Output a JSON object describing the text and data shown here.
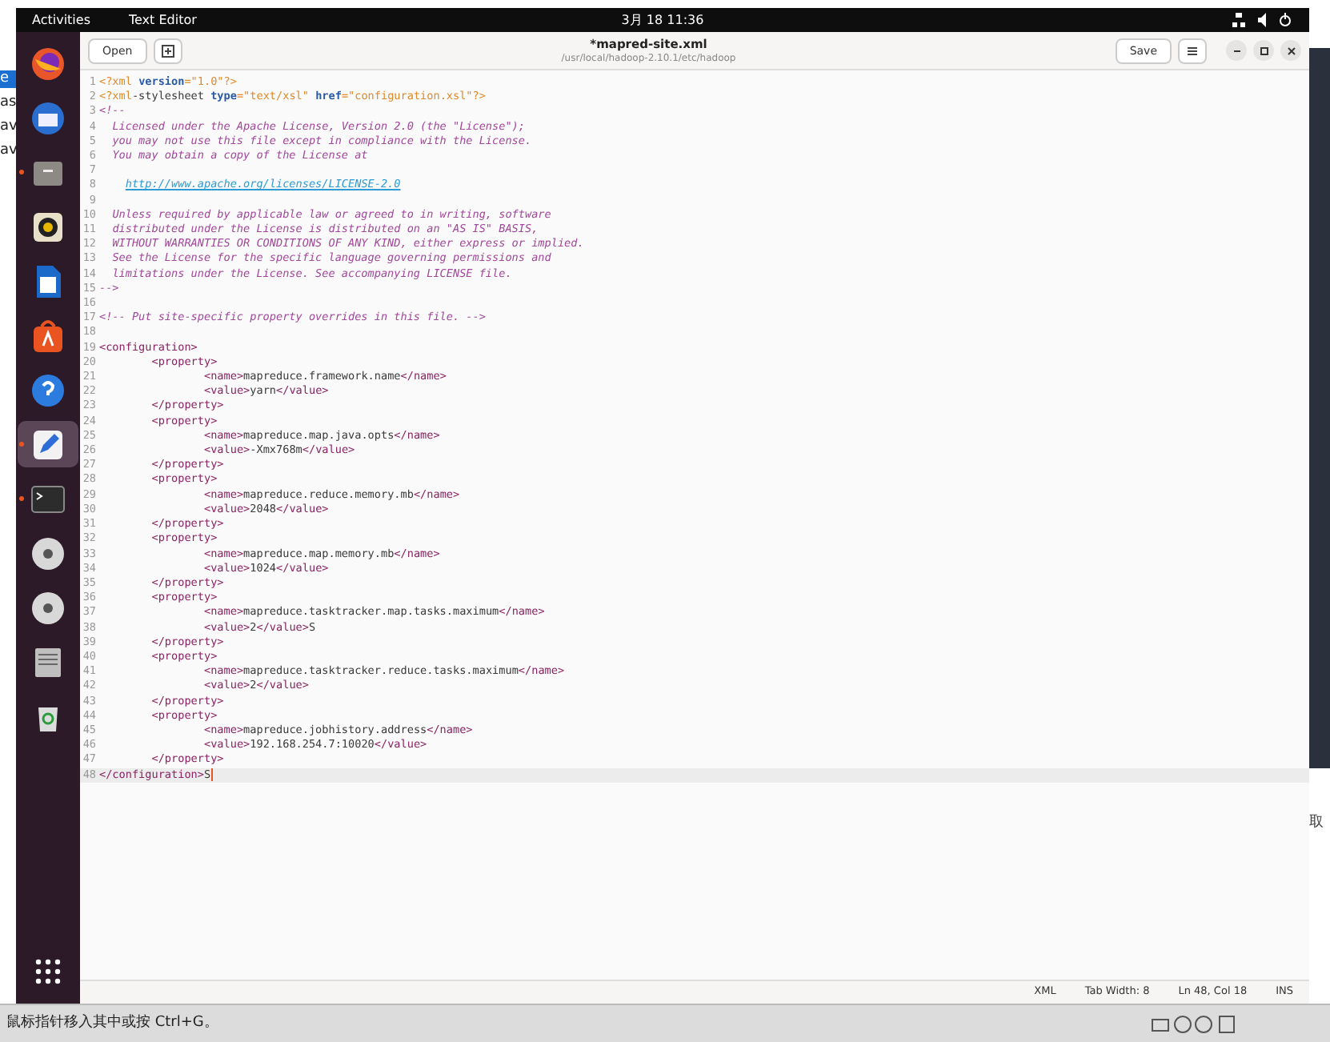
{
  "host_left": [
    {
      "text": "e",
      "selected": true
    },
    {
      "text": "as",
      "selected": false
    },
    {
      "text": "av",
      "selected": false
    },
    {
      "text": "av",
      "selected": false
    }
  ],
  "top_bar": {
    "activities": "Activities",
    "app": "Text Editor",
    "clock": "3月 18 11:36"
  },
  "dock": [
    {
      "kind": "firefox",
      "running": false,
      "selected": false
    },
    {
      "kind": "mail",
      "running": false,
      "selected": false
    },
    {
      "kind": "files",
      "running": true,
      "selected": false
    },
    {
      "kind": "speaker",
      "running": false,
      "selected": false
    },
    {
      "kind": "document",
      "running": false,
      "selected": false
    },
    {
      "kind": "store",
      "running": false,
      "selected": false
    },
    {
      "kind": "help",
      "running": false,
      "selected": false
    },
    {
      "kind": "editor",
      "running": true,
      "selected": true
    },
    {
      "kind": "terminal",
      "running": true,
      "selected": false
    },
    {
      "kind": "disc",
      "running": false,
      "selected": false
    },
    {
      "kind": "disc",
      "running": false,
      "selected": false
    },
    {
      "kind": "drive",
      "running": false,
      "selected": false
    },
    {
      "kind": "trash",
      "running": false,
      "selected": false
    },
    {
      "kind": "grid",
      "running": false,
      "selected": false
    }
  ],
  "header": {
    "open": "Open",
    "title": "*mapred-site.xml",
    "path": "/usr/local/hadoop-2.10.1/etc/hadoop",
    "save": "Save"
  },
  "lines": [
    {
      "number": "1",
      "segments": [
        {
          "kind": "decl",
          "text": "<?xml "
        },
        {
          "kind": "attr",
          "text": "version"
        },
        {
          "kind": "decl",
          "text": "=\"1.0\"?>"
        }
      ]
    },
    {
      "number": "2",
      "segments": [
        {
          "kind": "decl",
          "text": "<?xml"
        },
        {
          "kind": "plain",
          "text": "-stylesheet "
        },
        {
          "kind": "attr",
          "text": "type"
        },
        {
          "kind": "decl",
          "text": "=\"text/xsl\" "
        },
        {
          "kind": "attr",
          "text": "href"
        },
        {
          "kind": "decl",
          "text": "=\"configuration.xsl\"?>"
        }
      ]
    },
    {
      "number": "3",
      "segments": [
        {
          "kind": "comment",
          "text": "<!--"
        }
      ]
    },
    {
      "number": "4",
      "segments": [
        {
          "kind": "comment",
          "text": "  Licensed under the Apache License, Version 2.0 (the \"License\");"
        }
      ]
    },
    {
      "number": "5",
      "segments": [
        {
          "kind": "comment",
          "text": "  you may not use this file except in compliance with the License."
        }
      ]
    },
    {
      "number": "6",
      "segments": [
        {
          "kind": "comment",
          "text": "  You may obtain a copy of the License at"
        }
      ]
    },
    {
      "number": "7"
    },
    {
      "number": "8",
      "segments": [
        {
          "kind": "link",
          "text": "    http://www.apache.org/licenses/LICENSE-2.0"
        }
      ]
    },
    {
      "number": "9"
    },
    {
      "number": "10",
      "segments": [
        {
          "kind": "comment",
          "text": "  Unless required by applicable law or agreed to in writing, software"
        }
      ]
    },
    {
      "number": "11",
      "segments": [
        {
          "kind": "comment",
          "text": "  distributed under the License is distributed on an \"AS IS\" BASIS,"
        }
      ]
    },
    {
      "number": "12",
      "segments": [
        {
          "kind": "comment",
          "text": "  WITHOUT WARRANTIES OR CONDITIONS OF ANY KIND, either express or implied."
        }
      ]
    },
    {
      "number": "13",
      "segments": [
        {
          "kind": "comment",
          "text": "  See the License for the specific language governing permissions and"
        }
      ]
    },
    {
      "number": "14",
      "segments": [
        {
          "kind": "comment",
          "text": "  limitations under the License. See accompanying LICENSE file."
        }
      ]
    },
    {
      "number": "15",
      "segments": [
        {
          "kind": "comment",
          "text": "-->"
        }
      ]
    },
    {
      "number": "16"
    },
    {
      "number": "17",
      "segments": [
        {
          "kind": "comment",
          "text": "<!-- Put site-specific property overrides in this file. -->"
        }
      ]
    },
    {
      "number": "18"
    },
    {
      "number": "19",
      "segments": [
        {
          "kind": "tag",
          "text": "<configuration>"
        }
      ]
    },
    {
      "number": "20",
      "segments": [
        {
          "kind": "tag",
          "text": "\t<property>"
        }
      ]
    },
    {
      "number": "21",
      "segments": [
        {
          "kind": "tag",
          "text": "\t\t<name>"
        },
        {
          "kind": "plain",
          "text": "mapreduce.framework.name"
        },
        {
          "kind": "tag",
          "text": "</name>"
        }
      ]
    },
    {
      "number": "22",
      "segments": [
        {
          "kind": "tag",
          "text": "\t\t<value>"
        },
        {
          "kind": "plain",
          "text": "yarn"
        },
        {
          "kind": "tag",
          "text": "</value>"
        }
      ]
    },
    {
      "number": "23",
      "segments": [
        {
          "kind": "tag",
          "text": "\t</property>"
        }
      ]
    },
    {
      "number": "24",
      "segments": [
        {
          "kind": "tag",
          "text": "\t<property>"
        }
      ]
    },
    {
      "number": "25",
      "segments": [
        {
          "kind": "tag",
          "text": "\t\t<name>"
        },
        {
          "kind": "plain",
          "text": "mapreduce.map.java.opts"
        },
        {
          "kind": "tag",
          "text": "</name>"
        }
      ]
    },
    {
      "number": "26",
      "segments": [
        {
          "kind": "tag",
          "text": "\t\t<value>"
        },
        {
          "kind": "plain",
          "text": "-Xmx768m"
        },
        {
          "kind": "tag",
          "text": "</value>"
        }
      ]
    },
    {
      "number": "27",
      "segments": [
        {
          "kind": "tag",
          "text": "\t</property>"
        }
      ]
    },
    {
      "number": "28",
      "segments": [
        {
          "kind": "tag",
          "text": "\t<property>"
        }
      ]
    },
    {
      "number": "29",
      "segments": [
        {
          "kind": "tag",
          "text": "\t\t<name>"
        },
        {
          "kind": "plain",
          "text": "mapreduce.reduce.memory.mb"
        },
        {
          "kind": "tag",
          "text": "</name>"
        }
      ]
    },
    {
      "number": "30",
      "segments": [
        {
          "kind": "tag",
          "text": "\t\t<value>"
        },
        {
          "kind": "plain",
          "text": "2048"
        },
        {
          "kind": "tag",
          "text": "</value>"
        }
      ]
    },
    {
      "number": "31",
      "segments": [
        {
          "kind": "tag",
          "text": "\t</property>"
        }
      ]
    },
    {
      "number": "32",
      "segments": [
        {
          "kind": "tag",
          "text": "\t<property>"
        }
      ]
    },
    {
      "number": "33",
      "segments": [
        {
          "kind": "tag",
          "text": "\t\t<name>"
        },
        {
          "kind": "plain",
          "text": "mapreduce.map.memory.mb"
        },
        {
          "kind": "tag",
          "text": "</name>"
        }
      ]
    },
    {
      "number": "34",
      "segments": [
        {
          "kind": "tag",
          "text": "\t\t<value>"
        },
        {
          "kind": "plain",
          "text": "1024"
        },
        {
          "kind": "tag",
          "text": "</value>"
        }
      ]
    },
    {
      "number": "35",
      "segments": [
        {
          "kind": "tag",
          "text": "\t</property>"
        }
      ]
    },
    {
      "number": "36",
      "segments": [
        {
          "kind": "tag",
          "text": "\t<property>"
        }
      ]
    },
    {
      "number": "37",
      "segments": [
        {
          "kind": "tag",
          "text": "\t\t<name>"
        },
        {
          "kind": "plain",
          "text": "mapreduce.tasktracker.map.tasks.maximum"
        },
        {
          "kind": "tag",
          "text": "</name>"
        }
      ]
    },
    {
      "number": "38",
      "segments": [
        {
          "kind": "tag",
          "text": "\t\t<value>"
        },
        {
          "kind": "plain",
          "text": "2"
        },
        {
          "kind": "tag",
          "text": "</value>"
        },
        {
          "kind": "plain",
          "text": "S"
        }
      ]
    },
    {
      "number": "39",
      "segments": [
        {
          "kind": "tag",
          "text": "\t</property>"
        }
      ]
    },
    {
      "number": "40",
      "segments": [
        {
          "kind": "tag",
          "text": "\t<property>"
        }
      ]
    },
    {
      "number": "41",
      "segments": [
        {
          "kind": "tag",
          "text": "\t\t<name>"
        },
        {
          "kind": "plain",
          "text": "mapreduce.tasktracker.reduce.tasks.maximum"
        },
        {
          "kind": "tag",
          "text": "</name>"
        }
      ]
    },
    {
      "number": "42",
      "segments": [
        {
          "kind": "tag",
          "text": "\t\t<value>"
        },
        {
          "kind": "plain",
          "text": "2"
        },
        {
          "kind": "tag",
          "text": "</value>"
        }
      ]
    },
    {
      "number": "43",
      "segments": [
        {
          "kind": "tag",
          "text": "\t</property>"
        }
      ]
    },
    {
      "number": "44",
      "segments": [
        {
          "kind": "tag",
          "text": "\t<property>"
        }
      ]
    },
    {
      "number": "45",
      "segments": [
        {
          "kind": "tag",
          "text": "\t\t<name>"
        },
        {
          "kind": "plain",
          "text": "mapreduce.jobhistory.address"
        },
        {
          "kind": "tag",
          "text": "</name>"
        }
      ]
    },
    {
      "number": "46",
      "segments": [
        {
          "kind": "tag",
          "text": "\t\t<value>"
        },
        {
          "kind": "plain",
          "text": "192.168.254.7:10020"
        },
        {
          "kind": "tag",
          "text": "</value>"
        }
      ]
    },
    {
      "number": "47",
      "segments": [
        {
          "kind": "tag",
          "text": "\t</property>"
        }
      ]
    },
    {
      "number": "48",
      "segments": [
        {
          "kind": "tag",
          "text": "</configuration>"
        },
        {
          "kind": "plain",
          "text": "S"
        }
      ],
      "current": true
    }
  ],
  "status_bar": {
    "language": "XML",
    "tab_width": "Tab Width: 8",
    "position": "Ln 48, Col 18",
    "mode": "INS"
  },
  "host_right": {
    "text": "取"
  },
  "host_bottom": {
    "hint": "鼠标指针移入其中或按 Ctrl+G。"
  }
}
